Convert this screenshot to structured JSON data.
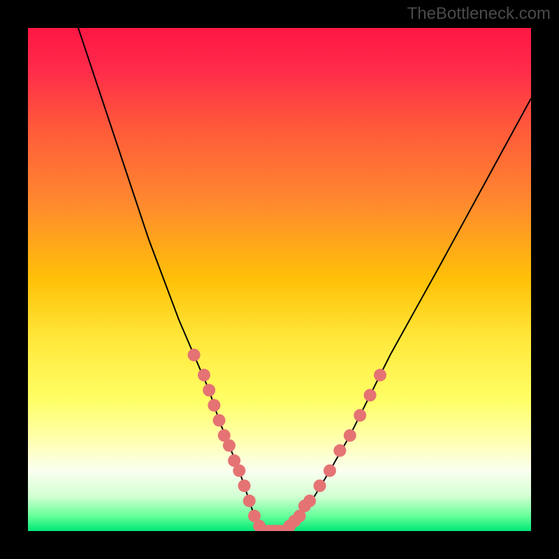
{
  "watermark": "TheBottleneck.com",
  "chart_data": {
    "type": "line",
    "title": "",
    "xlabel": "",
    "ylabel": "",
    "xlim": [
      0,
      100
    ],
    "ylim": [
      0,
      100
    ],
    "gradient_stops": [
      {
        "pos": 0.0,
        "color": "#ff1744"
      },
      {
        "pos": 0.08,
        "color": "#ff2a4a"
      },
      {
        "pos": 0.2,
        "color": "#ff5a3a"
      },
      {
        "pos": 0.35,
        "color": "#ff8a2e"
      },
      {
        "pos": 0.5,
        "color": "#ffc107"
      },
      {
        "pos": 0.62,
        "color": "#ffe83b"
      },
      {
        "pos": 0.74,
        "color": "#ffff66"
      },
      {
        "pos": 0.82,
        "color": "#ffffb0"
      },
      {
        "pos": 0.88,
        "color": "#fafff0"
      },
      {
        "pos": 0.93,
        "color": "#d4ffd4"
      },
      {
        "pos": 0.97,
        "color": "#66ff99"
      },
      {
        "pos": 1.0,
        "color": "#00e676"
      }
    ],
    "series": [
      {
        "name": "bottleneck-curve",
        "x": [
          10,
          15,
          20,
          24,
          27,
          30,
          33,
          36,
          38,
          40,
          42,
          43,
          44,
          45,
          46,
          48,
          50,
          52,
          54,
          57,
          60,
          64,
          68,
          72,
          77,
          82,
          88,
          94,
          100
        ],
        "y": [
          100,
          85,
          70,
          58,
          50,
          42,
          35,
          28,
          22,
          17,
          12,
          9,
          6,
          3,
          1,
          0,
          0,
          1,
          3,
          7,
          12,
          19,
          27,
          35,
          44,
          53,
          64,
          75,
          86
        ]
      }
    ],
    "highlight_points": {
      "name": "sample-dots",
      "color": "#e57373",
      "points": [
        {
          "x": 33,
          "y": 35
        },
        {
          "x": 35,
          "y": 31
        },
        {
          "x": 36,
          "y": 28
        },
        {
          "x": 37,
          "y": 25
        },
        {
          "x": 38,
          "y": 22
        },
        {
          "x": 39,
          "y": 19
        },
        {
          "x": 40,
          "y": 17
        },
        {
          "x": 41,
          "y": 14
        },
        {
          "x": 42,
          "y": 12
        },
        {
          "x": 43,
          "y": 9
        },
        {
          "x": 44,
          "y": 6
        },
        {
          "x": 45,
          "y": 3
        },
        {
          "x": 46,
          "y": 1
        },
        {
          "x": 47,
          "y": 0
        },
        {
          "x": 48,
          "y": 0
        },
        {
          "x": 49,
          "y": 0
        },
        {
          "x": 50,
          "y": 0
        },
        {
          "x": 51,
          "y": 0
        },
        {
          "x": 52,
          "y": 1
        },
        {
          "x": 53,
          "y": 2
        },
        {
          "x": 54,
          "y": 3
        },
        {
          "x": 55,
          "y": 5
        },
        {
          "x": 56,
          "y": 6
        },
        {
          "x": 58,
          "y": 9
        },
        {
          "x": 60,
          "y": 12
        },
        {
          "x": 62,
          "y": 16
        },
        {
          "x": 64,
          "y": 19
        },
        {
          "x": 66,
          "y": 23
        },
        {
          "x": 68,
          "y": 27
        },
        {
          "x": 70,
          "y": 31
        }
      ]
    }
  }
}
